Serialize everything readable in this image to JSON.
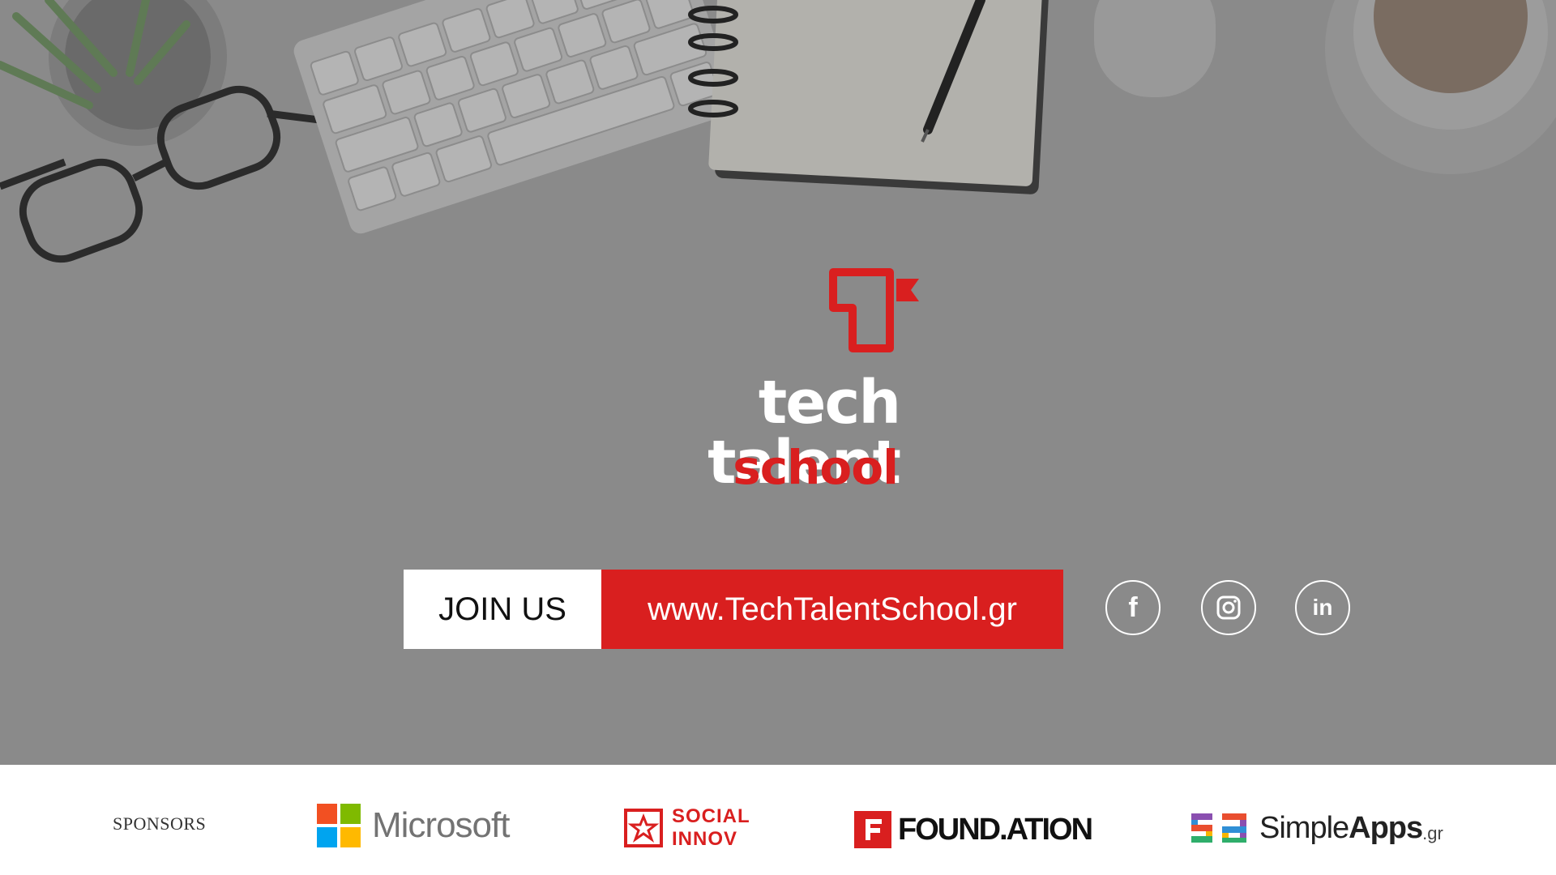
{
  "brand": {
    "word": "tech talent",
    "sub": "school",
    "accent_color": "#d91f1f"
  },
  "cta": {
    "join_label": "JOIN US",
    "url_label": "www.TechTalentSchool.gr"
  },
  "social": [
    {
      "icon": "facebook-icon",
      "glyph": "f"
    },
    {
      "icon": "instagram-icon",
      "glyph": ""
    },
    {
      "icon": "linkedin-icon",
      "glyph": "in"
    }
  ],
  "footer": {
    "sponsors_label": "SPONSORS",
    "sponsors": [
      {
        "name": "Microsoft"
      },
      {
        "line1": "SOCIAL",
        "line2": "INNOV"
      },
      {
        "name": "FOUND.ATION"
      },
      {
        "name_light": "Simple",
        "name_bold": "Apps",
        "suffix": ".gr"
      }
    ]
  }
}
